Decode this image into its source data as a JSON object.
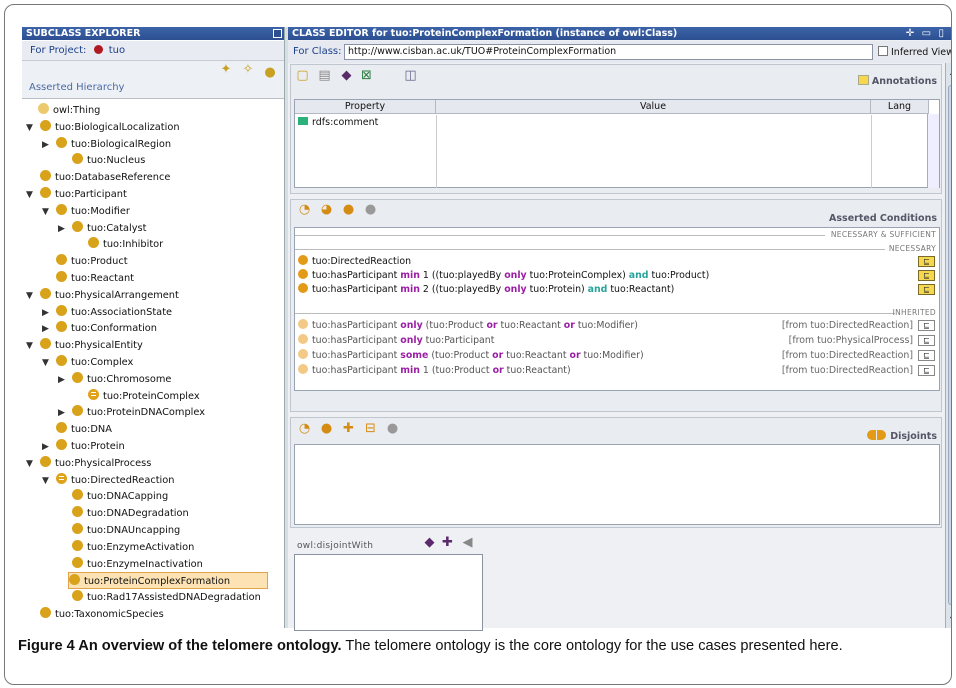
{
  "left_panel": {
    "title": "SUBCLASS EXPLORER",
    "project_label": "For Project:",
    "project_name": "tuo",
    "hierarchy_label": "Asserted Hierarchy",
    "tree": [
      {
        "label": "owl:Thing",
        "toggle": "",
        "icon": "class-icon-light"
      },
      {
        "label": "tuo:BiologicalLocalization",
        "toggle": "▼",
        "icon": "class-icon"
      },
      {
        "label": "tuo:BiologicalRegion",
        "toggle": "▶",
        "icon": "class-icon"
      },
      {
        "label": "tuo:Nucleus",
        "toggle": "",
        "icon": "class-icon"
      },
      {
        "label": "tuo:DatabaseReference",
        "toggle": "",
        "icon": "class-icon"
      },
      {
        "label": "tuo:Participant",
        "toggle": "▼",
        "icon": "class-icon"
      },
      {
        "label": "tuo:Modifier",
        "toggle": "▼",
        "icon": "class-icon"
      },
      {
        "label": "tuo:Catalyst",
        "toggle": "▶",
        "icon": "class-icon"
      },
      {
        "label": "tuo:Inhibitor",
        "toggle": "",
        "icon": "class-icon"
      },
      {
        "label": "tuo:Product",
        "toggle": "",
        "icon": "class-icon"
      },
      {
        "label": "tuo:Reactant",
        "toggle": "",
        "icon": "class-icon"
      },
      {
        "label": "tuo:PhysicalArrangement",
        "toggle": "▼",
        "icon": "class-icon"
      },
      {
        "label": "tuo:AssociationState",
        "toggle": "▶",
        "icon": "class-icon"
      },
      {
        "label": "tuo:Conformation",
        "toggle": "▶",
        "icon": "class-icon"
      },
      {
        "label": "tuo:PhysicalEntity",
        "toggle": "▼",
        "icon": "class-icon"
      },
      {
        "label": "tuo:Complex",
        "toggle": "▼",
        "icon": "class-icon"
      },
      {
        "label": "tuo:Chromosome",
        "toggle": "▶",
        "icon": "class-icon"
      },
      {
        "label": "tuo:ProteinComplex",
        "toggle": "",
        "icon": "defined-class-icon"
      },
      {
        "label": "tuo:ProteinDNAComplex",
        "toggle": "▶",
        "icon": "class-icon"
      },
      {
        "label": "tuo:DNA",
        "toggle": "",
        "icon": "class-icon"
      },
      {
        "label": "tuo:Protein",
        "toggle": "▶",
        "icon": "class-icon"
      },
      {
        "label": "tuo:PhysicalProcess",
        "toggle": "▼",
        "icon": "class-icon"
      },
      {
        "label": "tuo:DirectedReaction",
        "toggle": "▼",
        "icon": "defined-class-icon"
      },
      {
        "label": "tuo:DNACapping",
        "toggle": "",
        "icon": "class-icon"
      },
      {
        "label": "tuo:DNADegradation",
        "toggle": "",
        "icon": "class-icon"
      },
      {
        "label": "tuo:DNAUncapping",
        "toggle": "",
        "icon": "class-icon"
      },
      {
        "label": "tuo:EnzymeActivation",
        "toggle": "",
        "icon": "class-icon"
      },
      {
        "label": "tuo:EnzymeInactivation",
        "toggle": "",
        "icon": "class-icon"
      },
      {
        "label": "tuo:ProteinComplexFormation",
        "toggle": "",
        "icon": "class-icon",
        "selected": true
      },
      {
        "label": "tuo:Rad17AssistedDNADegradation",
        "toggle": "",
        "icon": "class-icon"
      },
      {
        "label": "tuo:TaxonomicSpecies",
        "toggle": "",
        "icon": "class-icon"
      }
    ]
  },
  "editor": {
    "title": "CLASS EDITOR for tuo:ProteinComplexFormation   (instance of owl:Class)",
    "window_controls": "✛ ▭ ▯ ▯",
    "for_class_label": "For Class:",
    "for_class_url": "http://www.cisban.ac.uk/TUO#ProteinComplexFormation",
    "inferred_view_label": "Inferred View",
    "annotations_label": "Annotations",
    "table_headers": [
      "Property",
      "Value",
      "Lang"
    ],
    "annotation_rows": [
      {
        "property": "rdfs:comment",
        "value": "",
        "lang": ""
      }
    ],
    "asserted_conditions_label": "Asserted Conditions",
    "nec_suff_label": "NECESSARY & SUFFICIENT",
    "necessary_label": "NECESSARY",
    "inherited_label": "INHERITED",
    "necessary_conditions": [
      {
        "parts": [
          [
            "tuo:DirectedReaction",
            ""
          ]
        ]
      },
      {
        "parts": [
          [
            "tuo:hasParticipant ",
            ""
          ],
          [
            "min",
            "kw"
          ],
          [
            " 1 ((tuo:playedBy ",
            ""
          ],
          [
            "only",
            "kw"
          ],
          [
            " tuo:ProteinComplex) ",
            ""
          ],
          [
            "and",
            "kw2"
          ],
          [
            " tuo:Product)",
            ""
          ]
        ]
      },
      {
        "parts": [
          [
            "tuo:hasParticipant ",
            ""
          ],
          [
            "min",
            "kw"
          ],
          [
            " 2 ((tuo:playedBy ",
            ""
          ],
          [
            "only",
            "kw"
          ],
          [
            " tuo:Protein) ",
            ""
          ],
          [
            "and",
            "kw2"
          ],
          [
            " tuo:Reactant)",
            ""
          ]
        ]
      }
    ],
    "inherited_conditions": [
      {
        "parts": [
          [
            "tuo:hasParticipant ",
            ""
          ],
          [
            "only",
            "kw"
          ],
          [
            " (tuo:Product ",
            ""
          ],
          [
            "or",
            "kw"
          ],
          [
            " tuo:Reactant ",
            ""
          ],
          [
            "or",
            "kw"
          ],
          [
            " tuo:Modifier)",
            ""
          ]
        ],
        "from": "[from tuo:DirectedReaction]"
      },
      {
        "parts": [
          [
            "tuo:hasParticipant ",
            ""
          ],
          [
            "only",
            "kw"
          ],
          [
            " tuo:Participant",
            ""
          ]
        ],
        "from": "[from tuo:PhysicalProcess]"
      },
      {
        "parts": [
          [
            "tuo:hasParticipant ",
            ""
          ],
          [
            "some",
            "kw"
          ],
          [
            " (tuo:Product ",
            ""
          ],
          [
            "or",
            "kw"
          ],
          [
            " tuo:Reactant ",
            ""
          ],
          [
            "or",
            "kw"
          ],
          [
            " tuo:Modifier)",
            ""
          ]
        ],
        "from": "[from tuo:DirectedReaction]"
      },
      {
        "parts": [
          [
            "tuo:hasParticipant ",
            ""
          ],
          [
            "min",
            "kw"
          ],
          [
            " 1 (tuo:Product ",
            ""
          ],
          [
            "or",
            "kw"
          ],
          [
            " tuo:Reactant)",
            ""
          ]
        ],
        "from": "[from tuo:DirectedReaction]"
      }
    ],
    "eq_button_label": "⊑",
    "disjoints_label": "Disjoints",
    "disjoint_with_label": "owl:disjointWith"
  },
  "caption": {
    "bold": "Figure 4 An overview of the telomere ontology.",
    "text": " The telomere ontology is the core ontology for the use cases presented here."
  },
  "colors": {
    "title_bar": "#2c4f91",
    "class_icon": "#d8a21b",
    "keyword": "#9b1fa5",
    "and_keyword": "#27a39a",
    "selection": "#fde3b3"
  }
}
